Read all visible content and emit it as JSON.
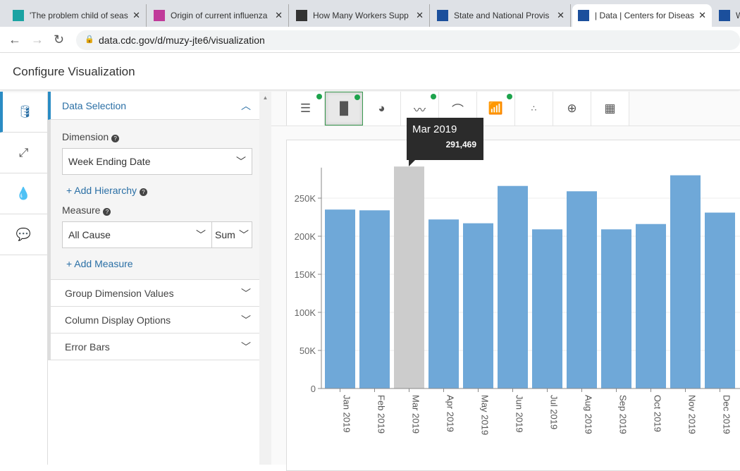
{
  "browser": {
    "tabs": [
      {
        "title": "'The problem child of seasonal",
        "favicon": "STAT",
        "color": "#1aa3a3"
      },
      {
        "title": "Origin of current influenza",
        "favicon": "✺",
        "color": "#c03a9a"
      },
      {
        "title": "How Many Workers Supp",
        "favicon": "⩚",
        "color": "#333333"
      },
      {
        "title": "State and National Provis",
        "favicon": "CDC",
        "color": "#1b4f9c"
      },
      {
        "title": "| Data | Centers for Disease",
        "favicon": "CDC",
        "color": "#1b4f9c"
      },
      {
        "title": "W",
        "favicon": "CDC",
        "color": "#1b4f9c"
      }
    ],
    "url": "data.cdc.gov/d/muzy-jte6/visualization"
  },
  "header": {
    "title": "Configure Visualization"
  },
  "panel": {
    "section": "Data Selection",
    "dimension_label": "Dimension",
    "dimension_value": "Week Ending Date",
    "add_hierarchy": "+ Add Hierarchy",
    "measure_label": "Measure",
    "measure_value": "All Cause",
    "aggregation": "Sum",
    "add_measure": "+ Add Measure",
    "collapsed": [
      "Group Dimension Values",
      "Column Display Options",
      "Error Bars"
    ]
  },
  "chart_types": [
    "bar-horizontal",
    "bar-vertical",
    "pie",
    "line",
    "histogram",
    "combo",
    "scatter",
    "map",
    "table"
  ],
  "tooltip": {
    "label": "Mar 2019",
    "value": "291,469"
  },
  "chart_data": {
    "type": "bar",
    "categories": [
      "Jan 2019",
      "Feb 2019",
      "Mar 2019",
      "Apr 2019",
      "May 2019",
      "Jun 2019",
      "Jul 2019",
      "Aug 2019",
      "Sep 2019",
      "Oct 2019",
      "Nov 2019",
      "Dec 2019"
    ],
    "values": [
      235000,
      234000,
      291469,
      222000,
      217000,
      266000,
      209000,
      259000,
      209000,
      216000,
      280000,
      231000
    ],
    "yticks": [
      "0",
      "50K",
      "100K",
      "150K",
      "200K",
      "250K"
    ],
    "ylim": [
      0,
      290000
    ],
    "highlighted": "Mar 2019",
    "bar_color": "#6fa8d8",
    "highlight_color": "#cccccc",
    "grid": true
  }
}
